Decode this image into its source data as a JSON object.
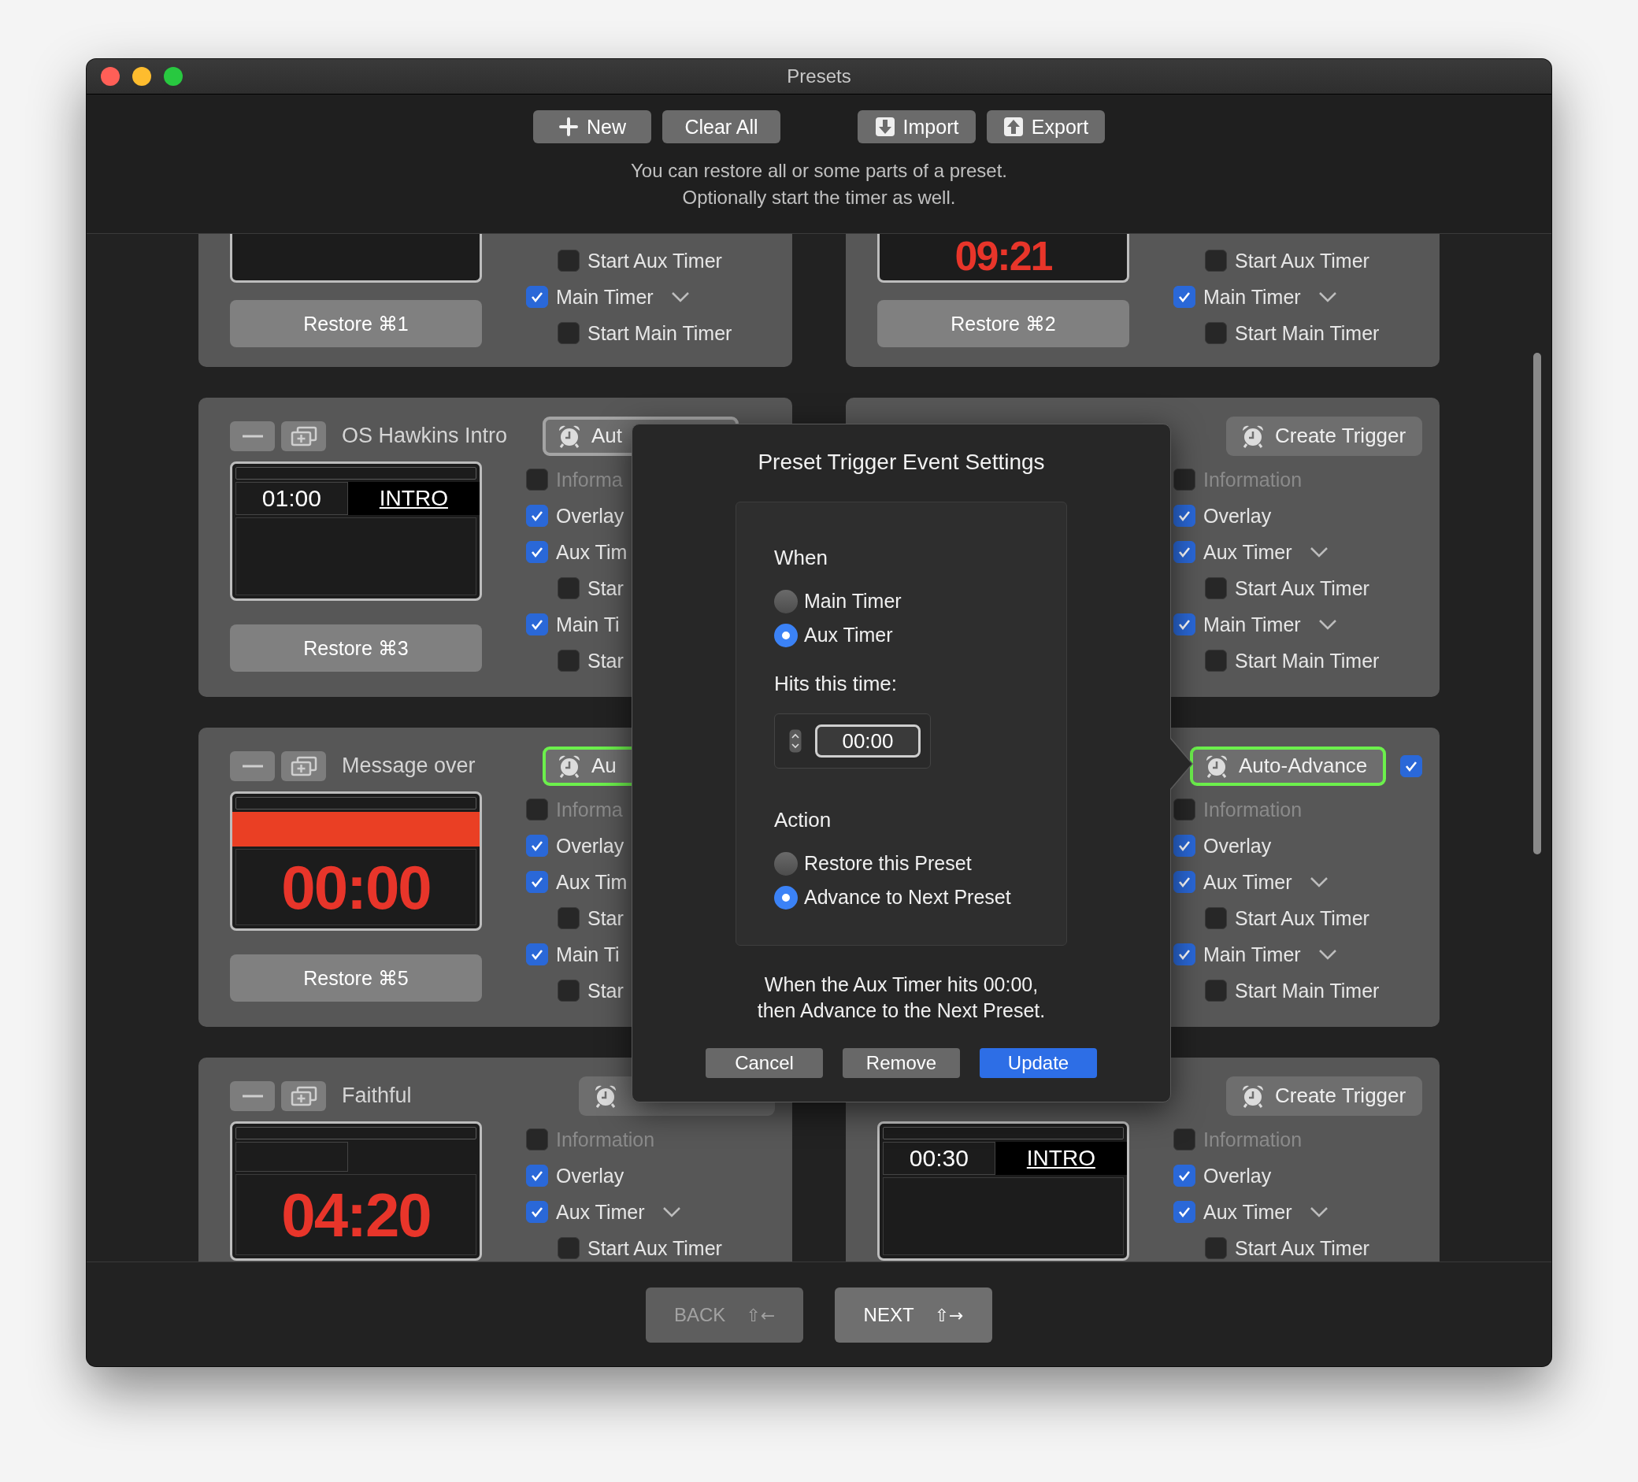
{
  "window": {
    "title": "Presets"
  },
  "toolbar": {
    "groups": [
      [
        {
          "label": "New"
        },
        {
          "label": "Clear All"
        }
      ],
      [
        {
          "label": "Import"
        },
        {
          "label": "Export"
        }
      ]
    ],
    "hint": "You can restore all or some parts of a preset.\nOptionally start the timer as well."
  },
  "presets": [
    {
      "preview": {
        "kind": "empty"
      },
      "restore": "Restore ⌘1",
      "items": [
        {
          "label": "Start Aux Timer",
          "kind": "sub",
          "checked": false
        },
        {
          "label": "Main Timer",
          "kind": "main",
          "checked": true,
          "dropdown": true
        },
        {
          "label": "Start Main Timer",
          "kind": "sub",
          "checked": false
        }
      ]
    },
    {
      "preview": {
        "kind": "clock",
        "time": "09:21"
      },
      "restore": "Restore ⌘2",
      "items": [
        {
          "label": "Start Aux Timer",
          "kind": "sub",
          "checked": false
        },
        {
          "label": "Main Timer",
          "kind": "main",
          "checked": true,
          "dropdown": true
        },
        {
          "label": "Start Main Timer",
          "kind": "sub",
          "checked": false
        }
      ]
    },
    {
      "name": "OS Hawkins Intro",
      "trigger": {
        "label": "Aut",
        "kind": "set"
      },
      "preview": {
        "kind": "split",
        "time": "01:00",
        "label": "INTRO"
      },
      "restore": "Restore ⌘3",
      "items": [
        {
          "label": "Informa",
          "kind": "main",
          "checked": false,
          "disabled": true
        },
        {
          "label": "Overlay",
          "kind": "main",
          "checked": true
        },
        {
          "label": "Aux Tim",
          "kind": "main",
          "checked": true
        },
        {
          "label": "Star",
          "kind": "sub",
          "checked": false
        },
        {
          "label": "Main Ti",
          "kind": "main",
          "checked": true
        },
        {
          "label": "Star",
          "kind": "sub",
          "checked": false
        }
      ]
    },
    {
      "trigger": {
        "label": "Create Trigger",
        "kind": "create"
      },
      "items": [
        {
          "label": "Information",
          "kind": "main",
          "checked": false,
          "disabled": true
        },
        {
          "label": "Overlay",
          "kind": "main",
          "checked": true
        },
        {
          "label": "Aux Timer",
          "kind": "main",
          "checked": true,
          "dropdown": true
        },
        {
          "label": "Start Aux Timer",
          "kind": "sub",
          "checked": false
        },
        {
          "label": "Main Timer",
          "kind": "main",
          "checked": true,
          "dropdown": true
        },
        {
          "label": "Start Main Timer",
          "kind": "sub",
          "checked": false
        }
      ]
    },
    {
      "name": "Message over",
      "trigger": {
        "label": "Au",
        "kind": "active"
      },
      "preview": {
        "kind": "message",
        "time": "00:00"
      },
      "restore": "Restore ⌘5",
      "items": [
        {
          "label": "Informa",
          "kind": "main",
          "checked": false,
          "disabled": true
        },
        {
          "label": "Overlay",
          "kind": "main",
          "checked": true
        },
        {
          "label": "Aux Tim",
          "kind": "main",
          "checked": true
        },
        {
          "label": "Star",
          "kind": "sub",
          "checked": false
        },
        {
          "label": "Main Ti",
          "kind": "main",
          "checked": true
        },
        {
          "label": "Star",
          "kind": "sub",
          "checked": false
        }
      ]
    },
    {
      "trigger": {
        "label": "Auto-Advance",
        "kind": "active",
        "enabled": true
      },
      "items": [
        {
          "label": "Information",
          "kind": "main",
          "checked": false,
          "disabled": true
        },
        {
          "label": "Overlay",
          "kind": "main",
          "checked": true
        },
        {
          "label": "Aux Timer",
          "kind": "main",
          "checked": true,
          "dropdown": true
        },
        {
          "label": "Start Aux Timer",
          "kind": "sub",
          "checked": false
        },
        {
          "label": "Main Timer",
          "kind": "main",
          "checked": true,
          "dropdown": true
        },
        {
          "label": "Start Main Timer",
          "kind": "sub",
          "checked": false
        }
      ]
    },
    {
      "name": "Faithful",
      "trigger": {
        "kind": "create"
      },
      "preview": {
        "kind": "clock",
        "time": "04:20"
      },
      "items": [
        {
          "label": "Information",
          "kind": "main",
          "checked": false,
          "disabled": true
        },
        {
          "label": "Overlay",
          "kind": "main",
          "checked": true
        },
        {
          "label": "Aux Timer",
          "kind": "main",
          "checked": true,
          "dropdown": true
        },
        {
          "label": "Start Aux Timer",
          "kind": "sub",
          "checked": false
        }
      ]
    },
    {
      "trigger": {
        "label": "Create Trigger",
        "kind": "create"
      },
      "preview": {
        "kind": "split",
        "time": "00:30",
        "label": "INTRO"
      },
      "items": [
        {
          "label": "Information",
          "kind": "main",
          "checked": false,
          "disabled": true
        },
        {
          "label": "Overlay",
          "kind": "main",
          "checked": true
        },
        {
          "label": "Aux Timer",
          "kind": "main",
          "checked": true,
          "dropdown": true
        },
        {
          "label": "Start Aux Timer",
          "kind": "sub",
          "checked": false
        }
      ]
    }
  ],
  "dialog": {
    "title": "Preset Trigger Event Settings",
    "when": {
      "heading": "When",
      "options": [
        {
          "label": "Main Timer",
          "selected": false
        },
        {
          "label": "Aux Timer",
          "selected": true
        }
      ]
    },
    "time_label": "Hits this time:",
    "time_value": "00:00",
    "action": {
      "heading": "Action",
      "options": [
        {
          "label": "Restore this Preset",
          "selected": false
        },
        {
          "label": "Advance to Next Preset",
          "selected": true
        }
      ]
    },
    "summary": "When the Aux Timer hits 00:00,\nthen Advance to the Next Preset.",
    "buttons": [
      {
        "label": "Cancel",
        "kind": "default"
      },
      {
        "label": "Remove",
        "kind": "default"
      },
      {
        "label": "Update",
        "kind": "primary"
      }
    ]
  },
  "footer": {
    "buttons": [
      {
        "label": "BACK",
        "shortcut": "⇧←",
        "disabled": true
      },
      {
        "label": "NEXT",
        "shortcut": "⇧→",
        "disabled": false
      }
    ]
  }
}
